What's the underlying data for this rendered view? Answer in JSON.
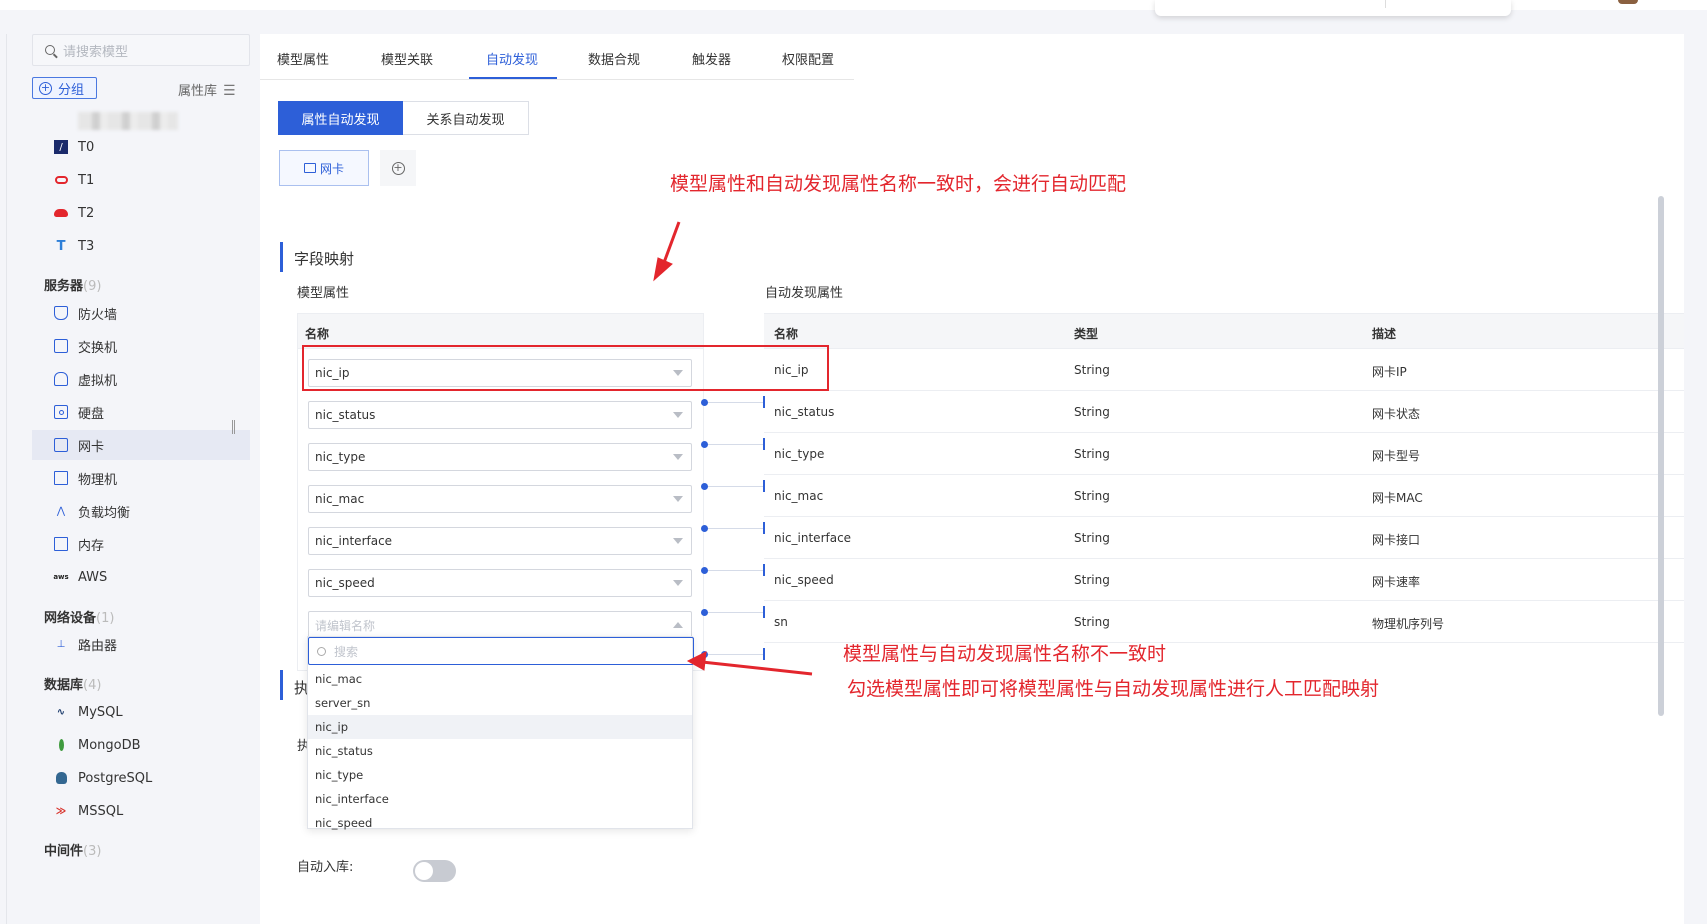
{
  "sidebar": {
    "search_placeholder": "请搜索模型",
    "group_button": "分组",
    "attr_lib": "属性库",
    "items_top": [
      {
        "icon": "template-icon",
        "label": "T0"
      },
      {
        "icon": "oracle-icon",
        "label": "T1"
      },
      {
        "icon": "redhat-icon",
        "label": "T2"
      },
      {
        "icon": "t-icon",
        "label": "T3"
      }
    ],
    "group_server": {
      "label": "服务器",
      "count": "(9)"
    },
    "items_server": [
      {
        "icon": "firewall-icon",
        "label": "防火墙"
      },
      {
        "icon": "switch-icon",
        "label": "交换机"
      },
      {
        "icon": "vm-icon",
        "label": "虚拟机"
      },
      {
        "icon": "disk-icon",
        "label": "硬盘"
      },
      {
        "icon": "nic-icon",
        "label": "网卡"
      },
      {
        "icon": "physical-machine-icon",
        "label": "物理机"
      },
      {
        "icon": "load-balancer-icon",
        "label": "负载均衡"
      },
      {
        "icon": "memory-icon",
        "label": "内存"
      },
      {
        "icon": "aws-icon",
        "label": "AWS"
      }
    ],
    "group_network": {
      "label": "网络设备",
      "count": "(1)"
    },
    "items_network": [
      {
        "icon": "router-icon",
        "label": "路由器"
      }
    ],
    "group_db": {
      "label": "数据库",
      "count": "(4)"
    },
    "items_db": [
      {
        "icon": "mysql-icon",
        "label": "MySQL"
      },
      {
        "icon": "mongodb-icon",
        "label": "MongoDB"
      },
      {
        "icon": "postgresql-icon",
        "label": "PostgreSQL"
      },
      {
        "icon": "mssql-icon",
        "label": "MSSQL"
      }
    ],
    "group_middleware": {
      "label": "中间件",
      "count": "(3)"
    }
  },
  "tabs": [
    "模型属性",
    "模型关联",
    "自动发现",
    "数据合规",
    "触发器",
    "权限配置"
  ],
  "active_tab": "自动发现",
  "sub_tabs": [
    "属性自动发现",
    "关系自动发现"
  ],
  "chip_label": "网卡",
  "section_field_mapping": "字段映射",
  "section_exec": "执",
  "section_exec_row": "执",
  "left_header": "模型属性",
  "right_header": "自动发现属性",
  "left_col_name": "名称",
  "right_cols": {
    "name": "名称",
    "type": "类型",
    "desc": "描述"
  },
  "mapping_rows": [
    {
      "model_attr": "nic_ip",
      "disc_name": "nic_ip",
      "type": "String",
      "desc": "网卡IP"
    },
    {
      "model_attr": "nic_status",
      "disc_name": "nic_status",
      "type": "String",
      "desc": "网卡状态"
    },
    {
      "model_attr": "nic_type",
      "disc_name": "nic_type",
      "type": "String",
      "desc": "网卡型号"
    },
    {
      "model_attr": "nic_mac",
      "disc_name": "nic_mac",
      "type": "String",
      "desc": "网卡MAC"
    },
    {
      "model_attr": "nic_interface",
      "disc_name": "nic_interface",
      "type": "String",
      "desc": "网卡接口"
    },
    {
      "model_attr": "nic_speed",
      "disc_name": "nic_speed",
      "type": "String",
      "desc": "网卡速率"
    },
    {
      "model_attr": "",
      "disc_name": "sn",
      "type": "String",
      "desc": "物理机序列号"
    }
  ],
  "select_placeholder": "请编辑名称",
  "dropdown": {
    "search_placeholder": "搜索",
    "options": [
      "nic_mac",
      "server_sn",
      "nic_ip",
      "nic_status",
      "nic_type",
      "nic_interface",
      "nic_speed"
    ],
    "highlighted": "nic_ip"
  },
  "auto_store_label": "自动入库:",
  "auto_store_on": false,
  "annotations": {
    "top": "模型属性和自动发现属性名称一致时，会进行自动匹配",
    "bottom_line1": "模型属性与自动发现属性名称不一致时",
    "bottom_line2": "勾选模型属性即可将模型属性与自动发现属性进行人工匹配映射"
  },
  "colors": {
    "accent": "#2d5fd8",
    "annotation": "#e3262d"
  }
}
